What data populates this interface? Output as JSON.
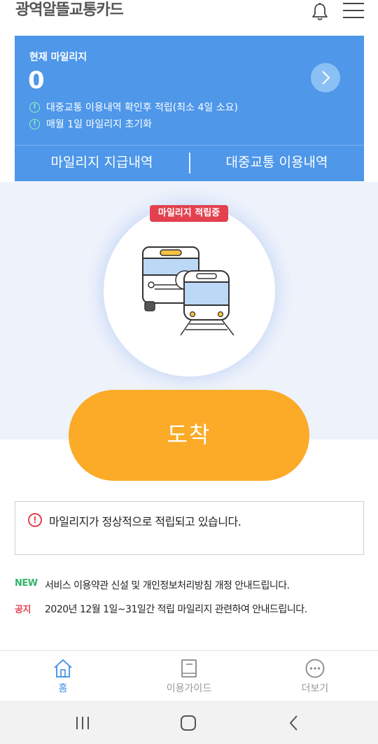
{
  "header": {
    "title": "광역알뜰교통카드",
    "bell_icon": "bell-icon",
    "menu_icon": "hamburger-menu-icon"
  },
  "mileage_card": {
    "label": "현재 마일리지",
    "value": "0",
    "notes": [
      "대중교통 이용내역 확인후 적립(최소 4일 소요)",
      "매월 1일 마일리지 초기화"
    ],
    "tabs": [
      "마일리지 지급내역",
      "대중교통 이용내역"
    ],
    "background_color": "#4e97e9"
  },
  "illustration": {
    "badge": "마일리지 적립중",
    "badge_color": "#e3414f"
  },
  "arrive_button": {
    "label": "도착",
    "color": "#fbab28"
  },
  "status": {
    "message": "마일리지가 정상적으로 적립되고 있습니다."
  },
  "notices": [
    {
      "tag": "NEW",
      "text": "서비스 이용약관 신설 및 개인정보처리방침 개정 안내드립니다."
    },
    {
      "tag": "공지",
      "text": "2020년 12월 1일~31일간 적립 마일리지 관련하여 안내드립니다."
    }
  ],
  "bottom_nav": [
    {
      "label": "홈",
      "icon": "home-icon",
      "active": true
    },
    {
      "label": "이용가이드",
      "icon": "book-icon",
      "active": false
    },
    {
      "label": "더보기",
      "icon": "more-icon",
      "active": false
    }
  ]
}
